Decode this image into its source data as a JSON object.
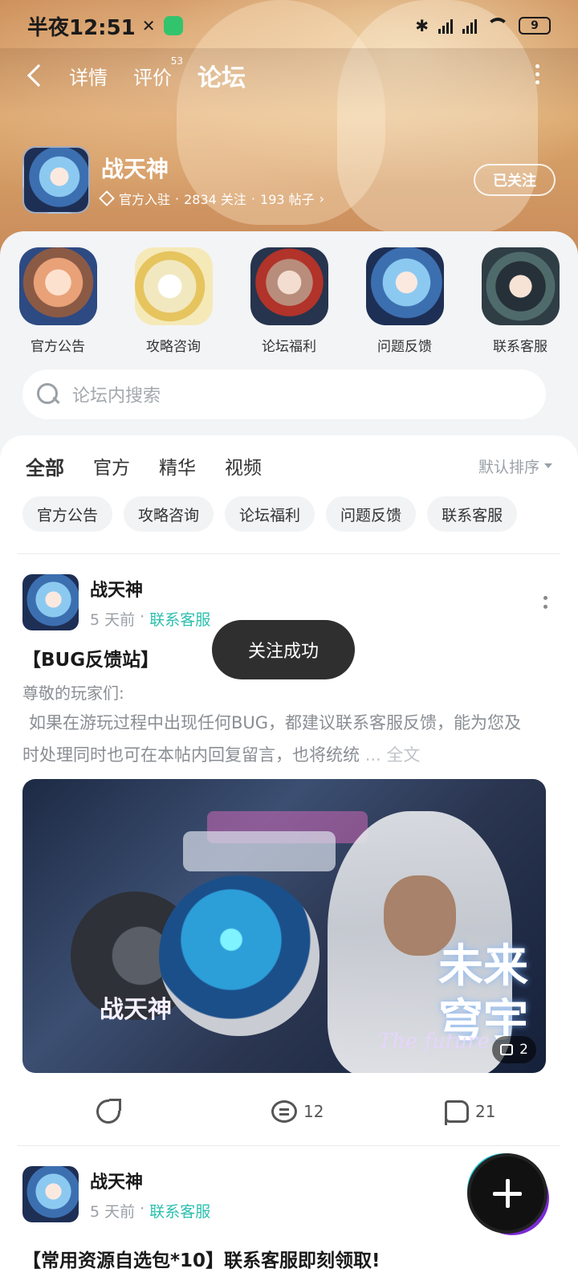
{
  "status_bar": {
    "time": "半夜12:51",
    "battery": "9"
  },
  "nav": {
    "back_icon": "chevron-left-icon",
    "tab_details": "详情",
    "tab_reviews": "评价",
    "reviews_count": "53",
    "tab_forum": "论坛",
    "more_icon": "vertical-dots-icon"
  },
  "game": {
    "name": "战天神",
    "verified_label": "官方入驻",
    "followers_text": "2834 关注",
    "posts_text": "193 帖子",
    "follow_button": "已关注"
  },
  "categories": [
    {
      "label": "官方公告"
    },
    {
      "label": "攻略咨询"
    },
    {
      "label": "论坛福利"
    },
    {
      "label": "问题反馈"
    },
    {
      "label": "联系客服"
    }
  ],
  "search": {
    "placeholder": "论坛内搜索"
  },
  "filter_tabs": {
    "all": "全部",
    "official": "官方",
    "featured": "精华",
    "video": "视频",
    "sort_label": "默认排序"
  },
  "chips": [
    {
      "label": "官方公告"
    },
    {
      "label": "攻略咨询"
    },
    {
      "label": "论坛福利"
    },
    {
      "label": "问题反馈"
    },
    {
      "label": "联系客服"
    }
  ],
  "post1": {
    "author": "战天神",
    "time": "5 天前",
    "category": "联系客服",
    "title": "【BUG反馈站】",
    "body_line1": "尊敬的玩家们:",
    "body_line2": "如果在游玩过程中出现任何BUG，都建议联系客服反馈，能为您及时处理同时也可在本帖内回复留言，也将统统",
    "ellipsis": "...",
    "full_text": "全文",
    "image_title_line1": "未来",
    "image_title_line2": "穹宇",
    "image_subtitle": "The future",
    "image_logo_text": "战天神",
    "image_count": "2",
    "comments": "12",
    "likes": "21"
  },
  "post2": {
    "author": "战天神",
    "time": "5 天前",
    "category": "联系客服",
    "title": "【常用资源自选包*10】联系客服即刻领取!"
  },
  "toast": {
    "message": "关注成功"
  },
  "colors": {
    "accent": "#2bbfae",
    "header_bg": "#d9a46a"
  }
}
